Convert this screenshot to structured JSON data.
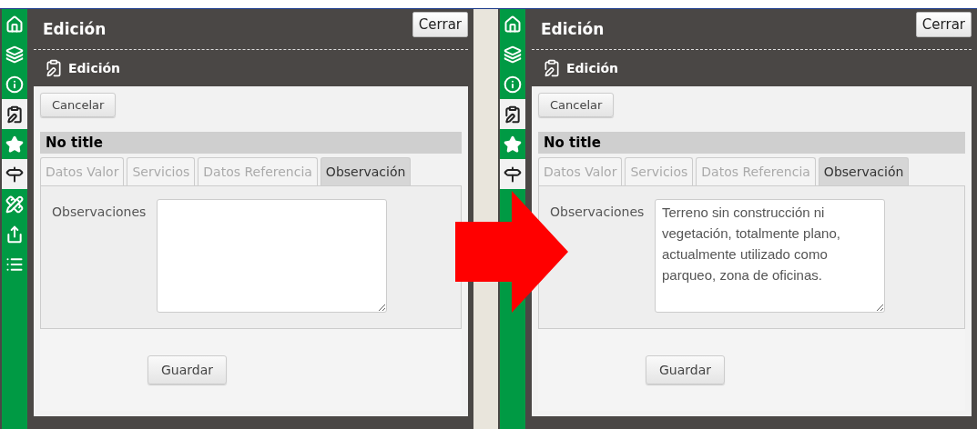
{
  "panels": [
    {
      "sidebar": {
        "items": [
          {
            "kind": "home",
            "selected": false
          },
          {
            "kind": "layers",
            "selected": false
          },
          {
            "kind": "info",
            "selected": false
          },
          {
            "kind": "edit",
            "selected": true
          },
          {
            "kind": "star",
            "selected": false
          },
          {
            "kind": "signpost",
            "selected": true
          },
          {
            "kind": "measure",
            "selected": false
          },
          {
            "kind": "share",
            "selected": false
          },
          {
            "kind": "list",
            "selected": false
          }
        ]
      },
      "header": {
        "title": "Edición",
        "close_button": "Cerrar"
      },
      "subheader": "Edición",
      "cancel_button": "Cancelar",
      "record_title": "No title",
      "tabs": [
        {
          "label": "Datos Valor",
          "selected": false
        },
        {
          "label": "Servicios",
          "selected": false
        },
        {
          "label": "Datos Referencia",
          "selected": false
        },
        {
          "label": "Observación",
          "selected": true
        }
      ],
      "field": {
        "label": "Observaciones"
      },
      "save_button": "Guardar"
    },
    {
      "sidebar": {
        "items": [
          {
            "kind": "home",
            "selected": false
          },
          {
            "kind": "layers",
            "selected": false
          },
          {
            "kind": "info",
            "selected": false
          },
          {
            "kind": "edit",
            "selected": true
          },
          {
            "kind": "star",
            "selected": false
          },
          {
            "kind": "signpost",
            "selected": true
          }
        ]
      },
      "header": {
        "title": "Edición",
        "close_button": "Cerrar"
      },
      "subheader": "Edición",
      "cancel_button": "Cancelar",
      "record_title": "No title",
      "tabs": [
        {
          "label": "Datos Valor",
          "selected": false
        },
        {
          "label": "Servicios",
          "selected": false
        },
        {
          "label": "Datos Referencia",
          "selected": false
        },
        {
          "label": "Observación",
          "selected": true
        }
      ],
      "field": {
        "label": "Observaciones",
        "value": "Terreno sin construcción ni vegetación, totalmente plano, actualmente utilizado como parqueo, zona de oficinas."
      },
      "save_button": "Guardar"
    }
  ]
}
